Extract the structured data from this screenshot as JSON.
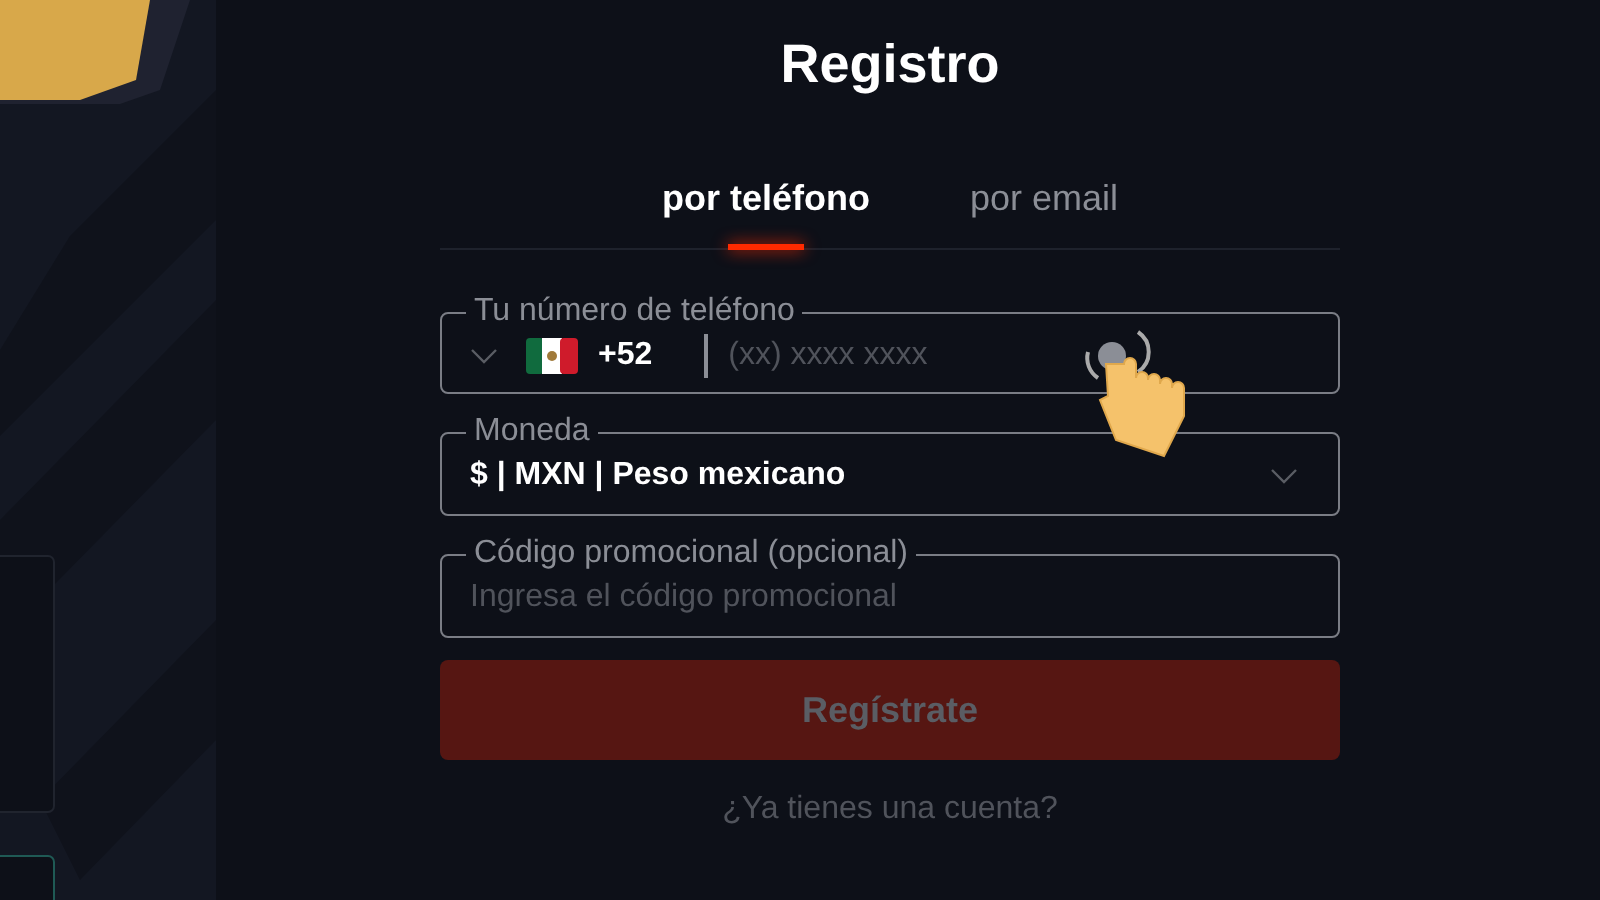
{
  "title": "Registro",
  "tabs": [
    {
      "label": "por teléfono",
      "selected": true
    },
    {
      "label": "por email",
      "selected": false
    }
  ],
  "phone": {
    "label": "Tu número de teléfono",
    "code": "+52",
    "placeholder": "(xx) xxxx xxxx"
  },
  "currency": {
    "label": "Moneda",
    "value": "$ | MXN | Peso mexicano"
  },
  "promo": {
    "label": "Código promocional (opcional)",
    "placeholder": "Ingresa el código promocional"
  },
  "submit": {
    "label": "Regístrate",
    "disabled": true
  },
  "login_link": "¿Ya tienes una cuenta?"
}
